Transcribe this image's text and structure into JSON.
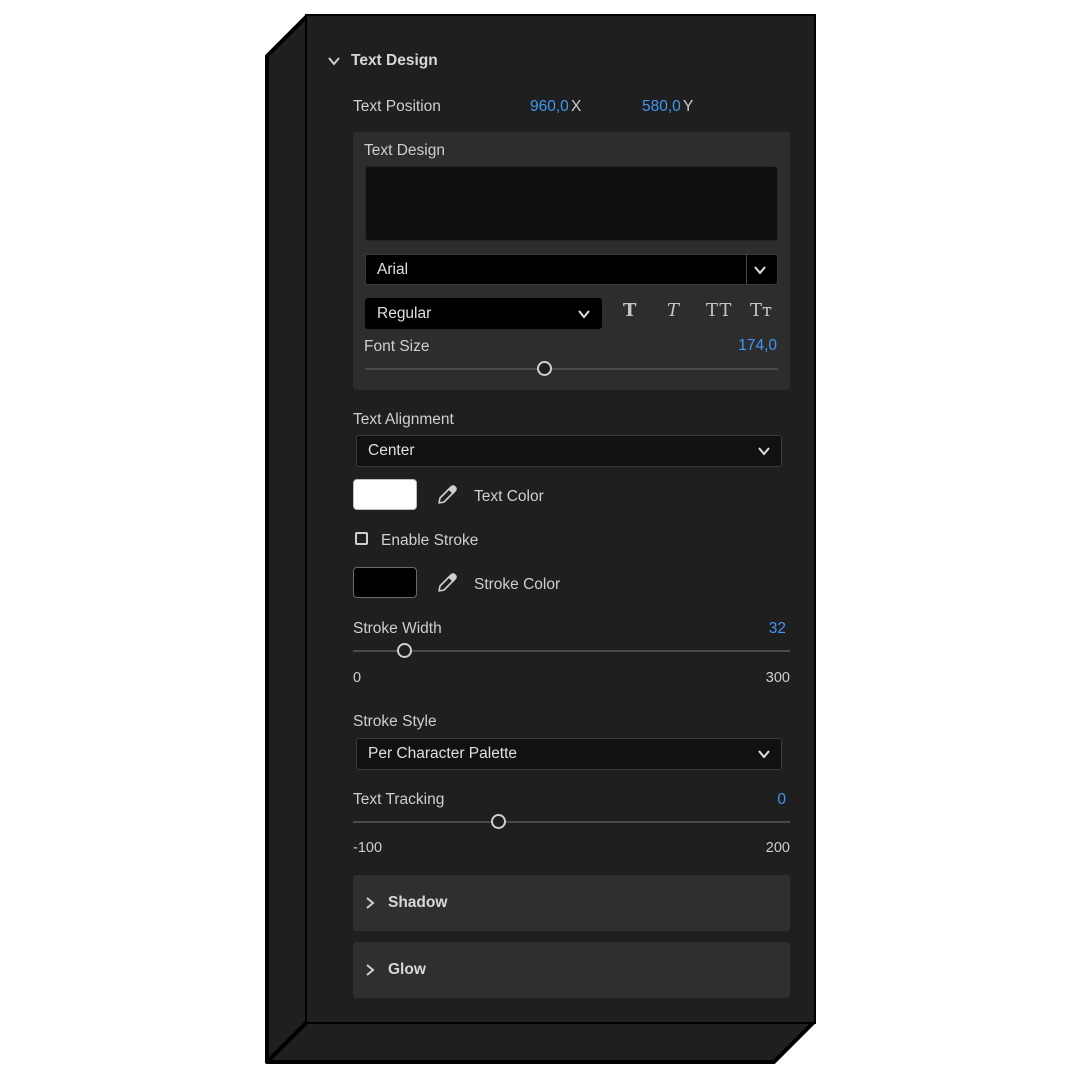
{
  "section": {
    "title": "Text Design",
    "icon": "chevron-down-icon"
  },
  "text_position": {
    "label": "Text Position",
    "x_value": "960,0",
    "x_axis": "X",
    "y_value": "580,0",
    "y_axis": "Y"
  },
  "text_design_box": {
    "label": "Text Design",
    "text_value": "",
    "font": {
      "value": "Arial",
      "icon": "chevron-down-icon"
    },
    "style": {
      "value": "Regular",
      "icon": "chevron-down-icon"
    },
    "format_buttons": [
      {
        "glyph": "T",
        "icon": "bold-icon"
      },
      {
        "glyph": "T",
        "icon": "italic-icon"
      },
      {
        "glyph": "TT",
        "icon": "all-caps-icon"
      },
      {
        "glyph": "Tт",
        "icon": "small-caps-icon"
      }
    ],
    "font_size": {
      "label": "Font Size",
      "value": "174,0",
      "fraction": 0.437
    }
  },
  "text_alignment": {
    "label": "Text Alignment",
    "value": "Center"
  },
  "text_color": {
    "label": "Text Color",
    "color": "#ffffff",
    "icon": "eyedropper-icon"
  },
  "enable_stroke": {
    "label": "Enable Stroke",
    "checked": false
  },
  "stroke_color": {
    "label": "Stroke Color",
    "color": "#000000",
    "icon": "eyedropper-icon"
  },
  "stroke_width": {
    "label": "Stroke Width",
    "value": "32",
    "min": "0",
    "max": "300",
    "fraction": 0.12
  },
  "stroke_style": {
    "label": "Stroke Style",
    "value": "Per Character Palette"
  },
  "text_tracking": {
    "label": "Text Tracking",
    "value": "0",
    "min": "-100",
    "max": "200",
    "fraction": 0.335
  },
  "shadow": {
    "label": "Shadow",
    "icon": "chevron-right-icon"
  },
  "glow": {
    "label": "Glow",
    "icon": "chevron-right-icon"
  },
  "colors": {
    "accent": "#3f96f5",
    "panel": "#1f1f1f",
    "subpanel": "#2d2d2d"
  }
}
